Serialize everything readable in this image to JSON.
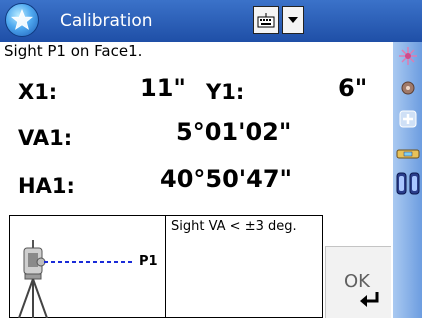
{
  "titlebar": {
    "title": "Calibration",
    "start_icon": "star-icon",
    "keyboard_icon": "keyboard-icon",
    "dropdown_icon": "chevron-down-icon"
  },
  "prompt": "Sight P1 on Face1.",
  "readings": {
    "x1_label": "X1:",
    "x1_value": "11\"",
    "y1_label": "Y1:",
    "y1_value": "6\"",
    "va1_label": "VA1:",
    "va1_value": "5°01'02\"",
    "ha1_label": "HA1:",
    "ha1_value": "40°50'47\""
  },
  "diagram": {
    "target_label": "P1",
    "instrument_icon": "total-station-icon"
  },
  "hint": "Sight VA < ±3 deg.",
  "ok_button": {
    "label": "OK",
    "icon": "enter-arrow-icon"
  },
  "right_toolbar": {
    "icons": [
      "laser-pointer-icon",
      "target-icon",
      "plus-icon",
      "level-icon",
      "battery-icon"
    ]
  },
  "colors": {
    "titlebar": "#2a5cb5",
    "toolbar": "#8fb6ea"
  }
}
